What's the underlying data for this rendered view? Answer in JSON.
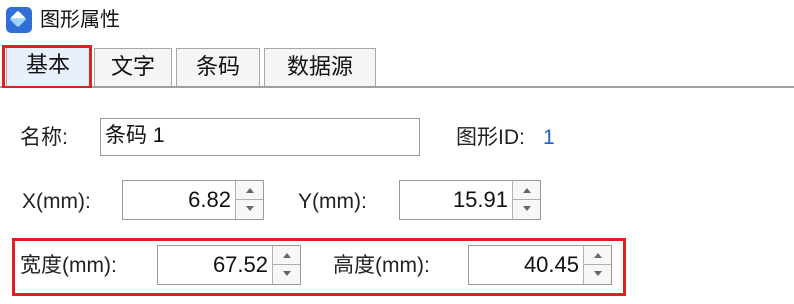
{
  "window": {
    "title": "图形属性",
    "icon": "app-diamond-icon"
  },
  "tabs": [
    {
      "label": "基本",
      "active": true
    },
    {
      "label": "文字",
      "active": false
    },
    {
      "label": "条码",
      "active": false
    },
    {
      "label": "数据源",
      "active": false
    }
  ],
  "basic": {
    "name_label": "名称:",
    "name_value": "条码 1",
    "id_label": "图形ID:",
    "id_value": "1",
    "x_label": "X(mm):",
    "x_value": "6.82",
    "y_label": "Y(mm):",
    "y_value": "15.91",
    "width_label": "宽度(mm):",
    "width_value": "67.52",
    "height_label": "高度(mm):",
    "height_value": "40.45"
  },
  "colors": {
    "highlight": "#e02020",
    "id_value": "#1f5fd0",
    "active_tab": "#e8f1fb"
  }
}
